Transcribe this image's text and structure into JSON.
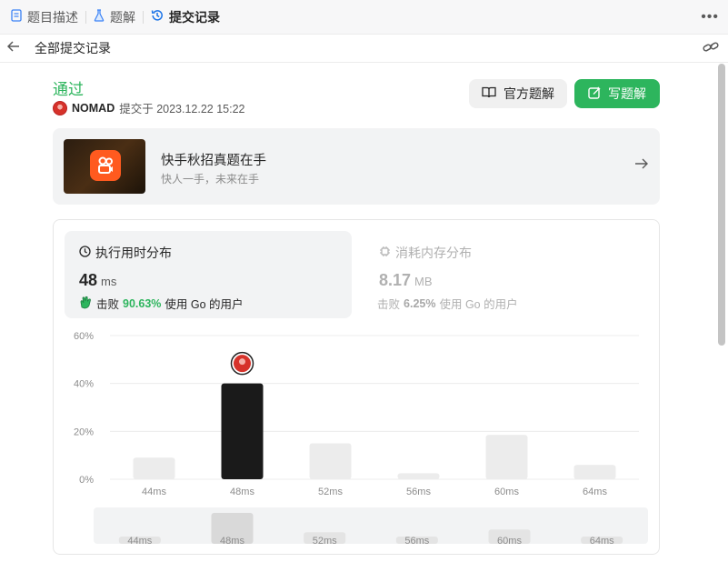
{
  "tabs": [
    {
      "label": "题目描述",
      "icon": "document-icon"
    },
    {
      "label": "题解",
      "icon": "flask-icon"
    },
    {
      "label": "提交记录",
      "icon": "history-icon",
      "active": true
    }
  ],
  "subbar": {
    "title": "全部提交记录"
  },
  "submission": {
    "status": "通过",
    "user": "NOMAD",
    "submitted_text": "提交于 2023.12.22 15:22"
  },
  "buttons": {
    "official": "官方题解",
    "write": "写题解"
  },
  "banner": {
    "title": "快手秋招真题在手",
    "subtitle": "快人一手，未来在手"
  },
  "runtime": {
    "title": "执行用时分布",
    "value": "48",
    "unit": "ms",
    "beat_prefix": "击败",
    "beat_pct": "90.63%",
    "beat_suffix": "使用 Go 的用户"
  },
  "memory": {
    "title": "消耗内存分布",
    "value": "8.17",
    "unit": "MB",
    "beat_prefix": "击败",
    "beat_pct": "6.25%",
    "beat_suffix": "使用 Go 的用户"
  },
  "colors": {
    "accent": "#2db55d",
    "bar": "#ececec",
    "bar_selected": "#1a1a1a"
  },
  "chart_data": {
    "type": "bar",
    "categories": [
      "44ms",
      "48ms",
      "52ms",
      "56ms",
      "60ms",
      "64ms"
    ],
    "values": [
      9,
      40,
      15,
      2.5,
      18.5,
      6
    ],
    "selected_index": 1,
    "yticks": [
      "0%",
      "20%",
      "40%",
      "60%"
    ],
    "ylim": [
      0,
      60
    ],
    "grid": true,
    "brush_categories": [
      "44ms",
      "48ms",
      "52ms",
      "56ms",
      "60ms",
      "64ms"
    ]
  }
}
